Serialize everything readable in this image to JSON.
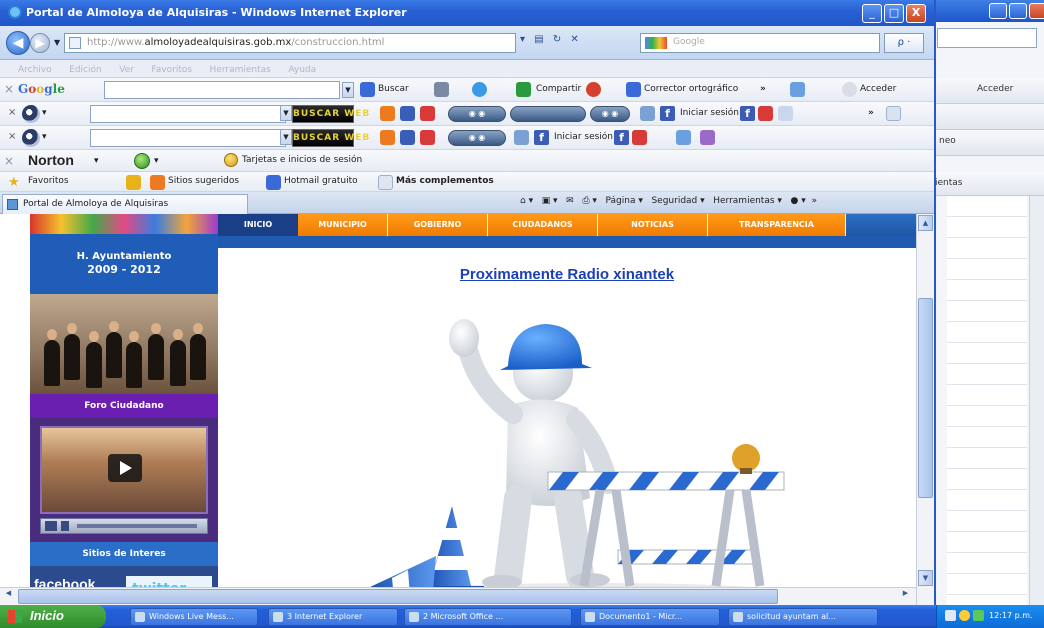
{
  "window": {
    "title": "Portal de Almoloya de Alquisiras - Windows Internet Explorer",
    "minimize": "_",
    "maximize": "□",
    "close": "X"
  },
  "nav": {
    "back": "◀",
    "forward": "▶",
    "url_prefix": "http://www.",
    "url_domain": "almoloyadealquisiras.gob.mx",
    "url_suffix": "/construccion.html",
    "search_placeholder": "Google",
    "search_go": "ρ ·"
  },
  "menu": [
    "Archivo",
    "Edición",
    "Ver",
    "Favoritos",
    "Herramientas",
    "Ayuda"
  ],
  "google_bar": {
    "logo": [
      "G",
      "o",
      "o",
      "g",
      "le"
    ],
    "buscar": "Buscar",
    "compartir": "Compartir",
    "corrector": "Corrector ortográfico",
    "acceder": "Acceder"
  },
  "buscar_bars": [
    {
      "button": "BUSCAR WEB",
      "radio_label": "",
      "login": "Iniciar sesión"
    },
    {
      "button": "BUSCAR WEB",
      "radio_label": "",
      "login": "Iniciar sesión"
    }
  ],
  "norton": {
    "logo": "Norton",
    "tarjetas": "Tarjetas e inicios de sesión"
  },
  "favorites": {
    "label": "Favoritos",
    "sitios": "Sitios sugeridos",
    "hotmail": "Hotmail gratuito",
    "mas": "Más complementos"
  },
  "tab": {
    "title": "Portal de Almoloya de Alquisiras",
    "pagina": "Página",
    "seguridad": "Seguridad",
    "herramientas": "Herramientas"
  },
  "site": {
    "nav": [
      "INICIO",
      "MUNICIPIO",
      "GOBIERNO",
      "CIUDADANOS",
      "NOTICIAS",
      "TRANSPARENCIA"
    ],
    "ayuntamiento": "H. Ayuntamiento",
    "years": "2009 - 2012",
    "foro": "Foro Ciudadano",
    "sitios": "Sitios de Interes",
    "facebook": "facebook",
    "twitter": "twitter",
    "heading": "Proximamente Radio xinantek"
  },
  "background_window": {
    "acceder": "Acceder",
    "herramientas": "ientas",
    "menu_partial": "neo"
  },
  "taskbar": {
    "start": "Inicio",
    "tasks": [
      "Windows Live Mess...",
      "3 Internet Explorer",
      "2 Microsoft Office ...",
      "Documento1 - Micr...",
      "solicitud ayuntam al..."
    ],
    "clock": "12:17 p.m."
  },
  "colors": {
    "xp_blue": "#2460d8",
    "orange_tab": "#f07b00",
    "sidebar_navy": "#1d2e78",
    "heading_blue": "#1a3fb8"
  }
}
